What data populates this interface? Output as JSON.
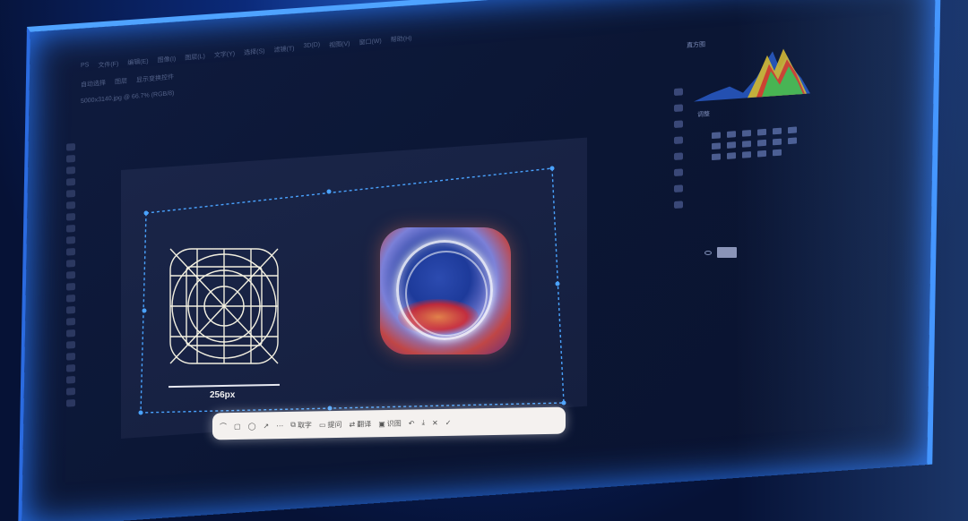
{
  "app": {
    "menu_row_1": [
      "PS",
      "文件(F)",
      "编辑(E)",
      "图像(I)",
      "图层(L)",
      "文字(Y)",
      "选择(S)",
      "滤镜(T)",
      "3D(D)",
      "视图(V)",
      "窗口(W)",
      "帮助(H)"
    ],
    "menu_row_2": [
      "自动选择",
      "图层",
      "显示变换控件"
    ],
    "doc_tab": "5000x3140.jpg @ 66.7% (RGB/8)"
  },
  "canvas": {
    "measure_label": "256px"
  },
  "screenshot_toolbar": {
    "text_extract_label": "取字",
    "ask_label": "提问",
    "translate_label": "翻译",
    "recognize_label": "识图"
  },
  "panels": {
    "histogram_tab": "直方图",
    "adjustments_label": "调整"
  },
  "colors": {
    "selection": "#4aa3ff",
    "toolbar_bg": "#f4f1ef",
    "screen_bg": "#0f1b3e"
  }
}
